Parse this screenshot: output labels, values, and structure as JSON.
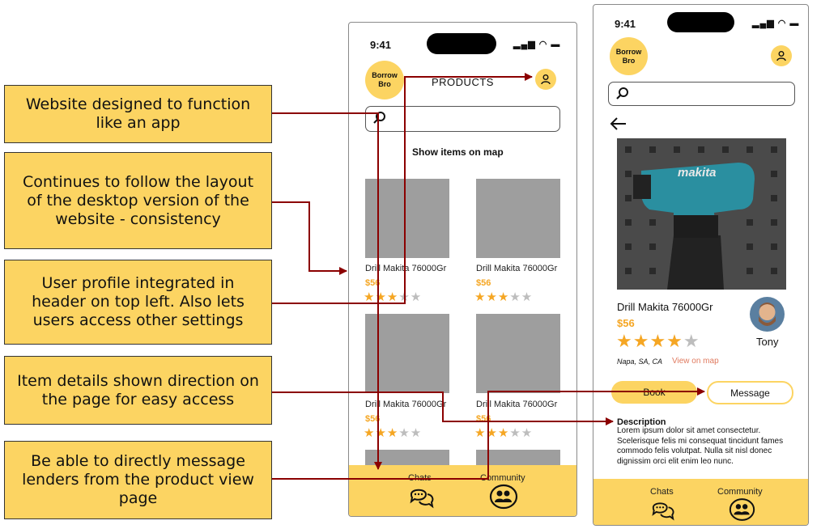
{
  "callouts": [
    "Website designed to function like an app",
    "Continues to follow the layout of the desktop version of the website - consistency",
    "User profile integrated in header on top left. Also lets users access other settings",
    "Item details shown direction on the page for easy access",
    "Be able to directly message lenders from the product view page"
  ],
  "phone1": {
    "time": "9:41",
    "logo_line1": "Borrow",
    "logo_line2": "Bro",
    "title": "PRODUCTS",
    "show_map": "Show items on map",
    "products": [
      {
        "name": "Drill Makita 76000Gr",
        "price": "$56",
        "rating": 3
      },
      {
        "name": "Drill Makita 76000Gr",
        "price": "$56",
        "rating": 3
      },
      {
        "name": "Drill Makita 76000Gr",
        "price": "$56",
        "rating": 3
      },
      {
        "name": "Drill Makita 76000Gr",
        "price": "$56",
        "rating": 3
      }
    ],
    "tab_chats": "Chats",
    "tab_community": "Community"
  },
  "phone2": {
    "time": "9:41",
    "logo_line1": "Borrow",
    "logo_line2": "Bro",
    "product_brand": "makita",
    "product_name": "Drill Makita 76000Gr",
    "price": "$56",
    "rating": 4,
    "owner": "Tony",
    "location": "Napa, SA, CA",
    "view_map": "View on map",
    "book_label": "Book",
    "message_label": "Message",
    "description_title": "Description",
    "description_text": "Lorem ipsum dolor sit amet consectetur. Scelerisque felis mi consequat tincidunt fames commodo felis volutpat. Nulla sit nisl donec dignissim orci elit enim leo nunc.",
    "tab_chats": "Chats",
    "tab_community": "Community"
  },
  "colors": {
    "accent": "#FCD462",
    "star": "#F5A623",
    "arrow": "#8B0000"
  }
}
